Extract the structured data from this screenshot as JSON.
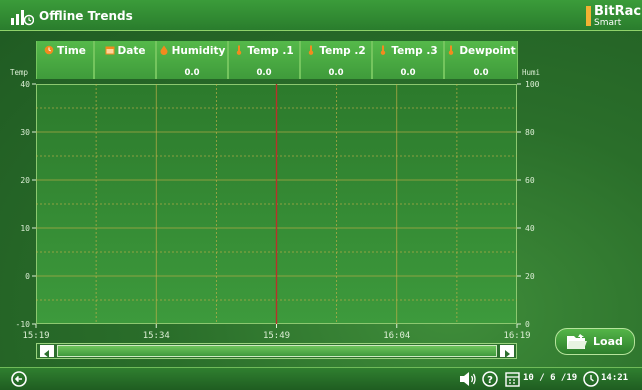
{
  "titlebar": {
    "title": "Offline Trends",
    "brand_name": "BitRack",
    "brand_sub": "Smart"
  },
  "columns": [
    {
      "label": "Time",
      "value": "",
      "icon": "clock-icon"
    },
    {
      "label": "Date",
      "value": "",
      "icon": "calendar-icon"
    },
    {
      "label": "Humidity",
      "value": "0.0",
      "icon": "humidity-icon"
    },
    {
      "label": "Temp .1",
      "value": "0.0",
      "icon": "thermometer-icon"
    },
    {
      "label": "Temp .2",
      "value": "0.0",
      "icon": "thermometer-icon"
    },
    {
      "label": "Temp .3",
      "value": "0.0",
      "icon": "thermometer-icon"
    },
    {
      "label": "Dewpoint",
      "value": "0.0",
      "icon": "dewpoint-icon"
    }
  ],
  "chart_data": {
    "type": "line",
    "ylabel": "Temp",
    "y2label": "Humi",
    "ylim": [
      -10,
      40
    ],
    "y2lim": [
      0,
      100
    ],
    "yticks": [
      "40",
      "30",
      "20",
      "10",
      "0",
      "-10"
    ],
    "y2ticks": [
      "100",
      "80",
      "60",
      "40",
      "20",
      "0"
    ],
    "xticks": [
      "15:19",
      "15:34",
      "15:49",
      "16:04",
      "16:19"
    ],
    "cursor_x": "15:49",
    "grid": true,
    "series": []
  },
  "actions": {
    "load_label": "Load"
  },
  "statusbar": {
    "date": "10 / 6 /19",
    "time": "14:21"
  },
  "colors": {
    "cursor": "#b8312a",
    "icon_orange": "#f28a1e",
    "grid": "#c9b14a"
  }
}
